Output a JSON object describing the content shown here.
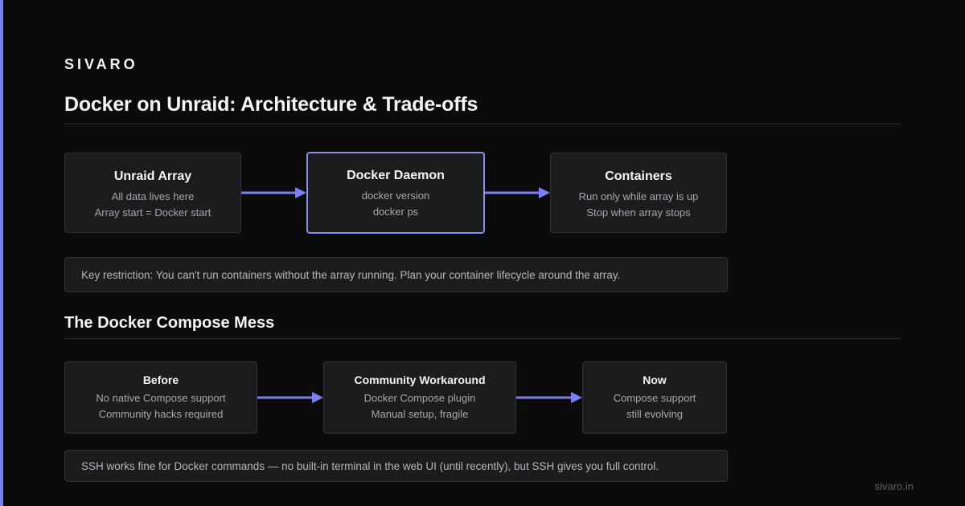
{
  "brand": "SIVARO",
  "title": "Docker on Unraid: Architecture & Trade-offs",
  "architecture": {
    "nodes": [
      {
        "title": "Unraid Array",
        "lines": [
          "All data lives here",
          "Array start = Docker start"
        ]
      },
      {
        "title": "Docker Daemon",
        "lines": [
          "docker version",
          "docker ps"
        ]
      },
      {
        "title": "Containers",
        "lines": [
          "Run only while array is up",
          "Stop when array stops"
        ]
      }
    ],
    "note": "Key restriction: You can't run containers without the array running. Plan your container lifecycle around the array."
  },
  "compose": {
    "heading": "The Docker Compose Mess",
    "nodes": [
      {
        "title": "Before",
        "lines": [
          "No native Compose support",
          "Community hacks required"
        ]
      },
      {
        "title": "Community Workaround",
        "lines": [
          "Docker Compose plugin",
          "Manual setup, fragile"
        ]
      },
      {
        "title": "Now",
        "lines": [
          "Compose support",
          "still evolving"
        ]
      }
    ],
    "note": "SSH works fine for Docker commands — no built-in terminal in the web UI (until recently), but SSH gives you full control."
  },
  "footer": "sivaro.in",
  "colors": {
    "background": "#0b0b0c",
    "accent": "#7c7ff2",
    "card": "#1c1c1f",
    "card_border": "#303035",
    "highlight_border": "#8a8df5"
  }
}
